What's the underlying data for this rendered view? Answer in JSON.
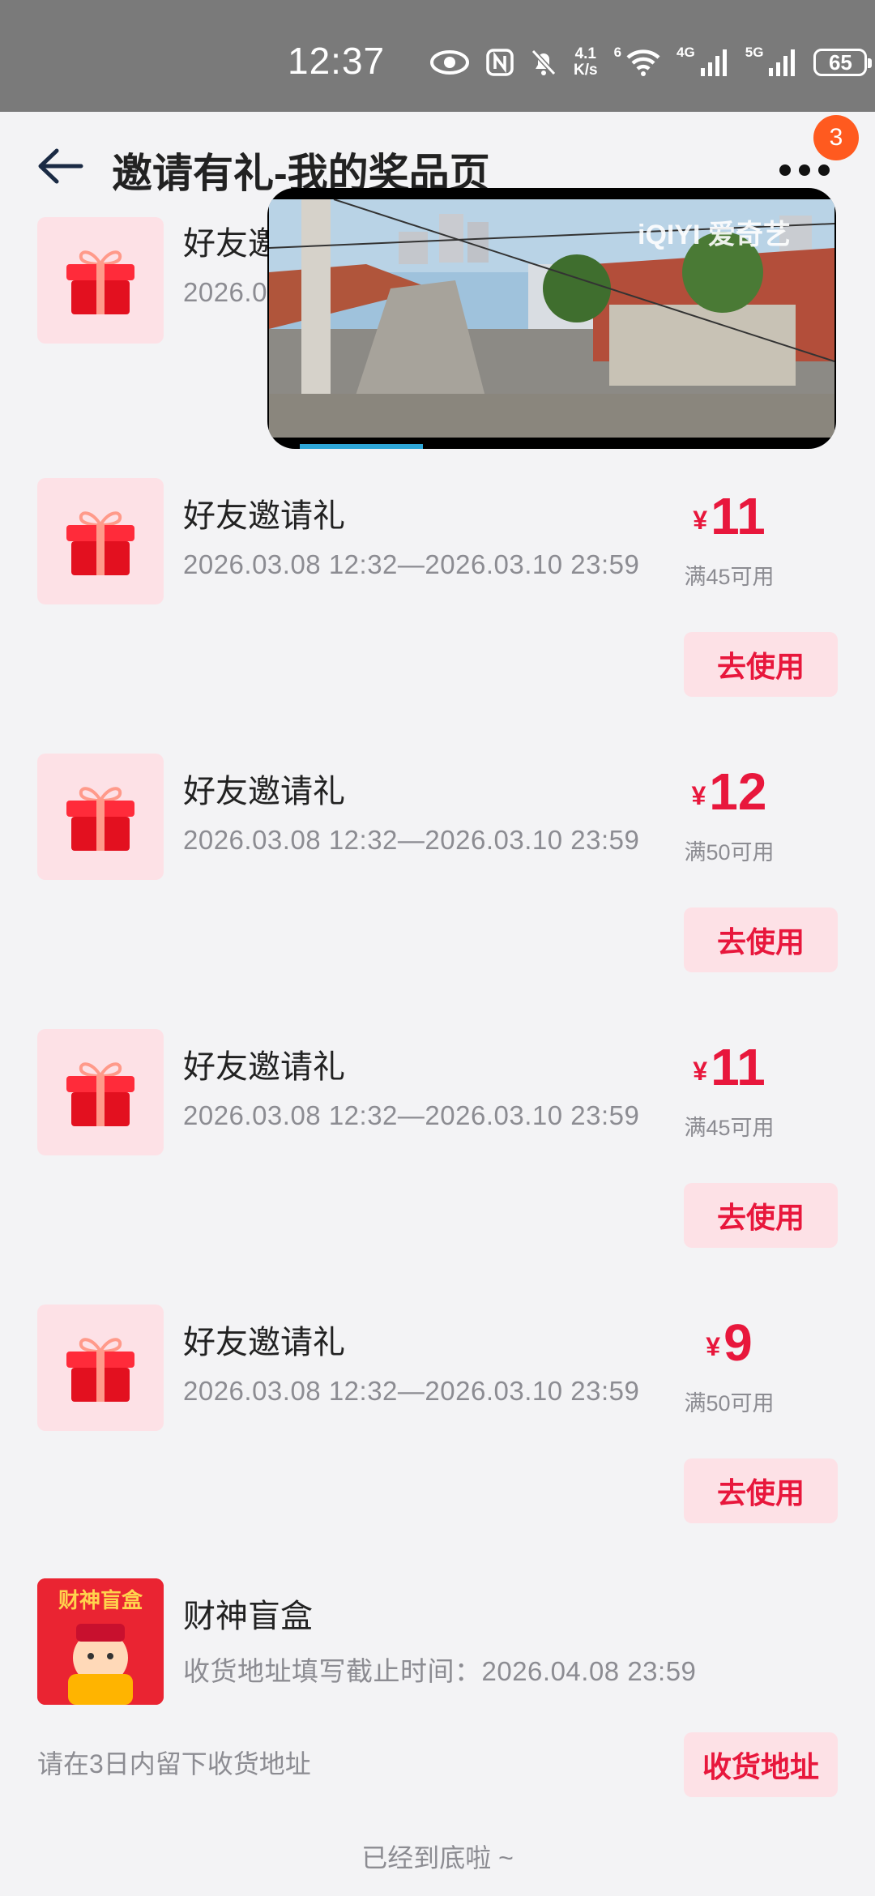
{
  "status_bar": {
    "time": "12:37",
    "net_speed_value": "4.1",
    "net_speed_unit": "K/s",
    "signal1_label": "4G",
    "signal2_label": "5G",
    "wifi_label": "6",
    "battery": "65"
  },
  "header": {
    "title": "邀请有礼-我的奖品页",
    "badge_count": "3"
  },
  "cards": [
    {
      "title": "好友邀请礼",
      "date": "2026.03.08 12:32—2026.03.10 23:59"
    },
    {
      "title": "好友邀请礼",
      "date": "2026.03.08 12:32—2026.03.10 23:59",
      "yen": "¥",
      "amount": "11",
      "condition": "满45可用",
      "button": "去使用"
    },
    {
      "title": "好友邀请礼",
      "date": "2026.03.08 12:32—2026.03.10 23:59",
      "yen": "¥",
      "amount": "12",
      "condition": "满50可用",
      "button": "去使用"
    },
    {
      "title": "好友邀请礼",
      "date": "2026.03.08 12:32—2026.03.10 23:59",
      "yen": "¥",
      "amount": "11",
      "condition": "满45可用",
      "button": "去使用"
    },
    {
      "title": "好友邀请礼",
      "date": "2026.03.08 12:32—2026.03.10 23:59",
      "yen": "¥",
      "amount": "9",
      "condition": "满50可用",
      "button": "去使用"
    }
  ],
  "blind_box": {
    "title": "财神盲盒",
    "deadline": "收货地址填写截止时间：2026.04.08 23:59",
    "note": "请在3日内留下收货地址",
    "button": "收货地址",
    "thumb_text": "财神盲盒"
  },
  "footer": "已经到底啦 ~",
  "video": {
    "logo": "iQIYI 爱奇艺"
  },
  "colors": {
    "accent": "#e8173c",
    "button_bg": "#fde1e6",
    "badge": "#ff5a1f"
  }
}
